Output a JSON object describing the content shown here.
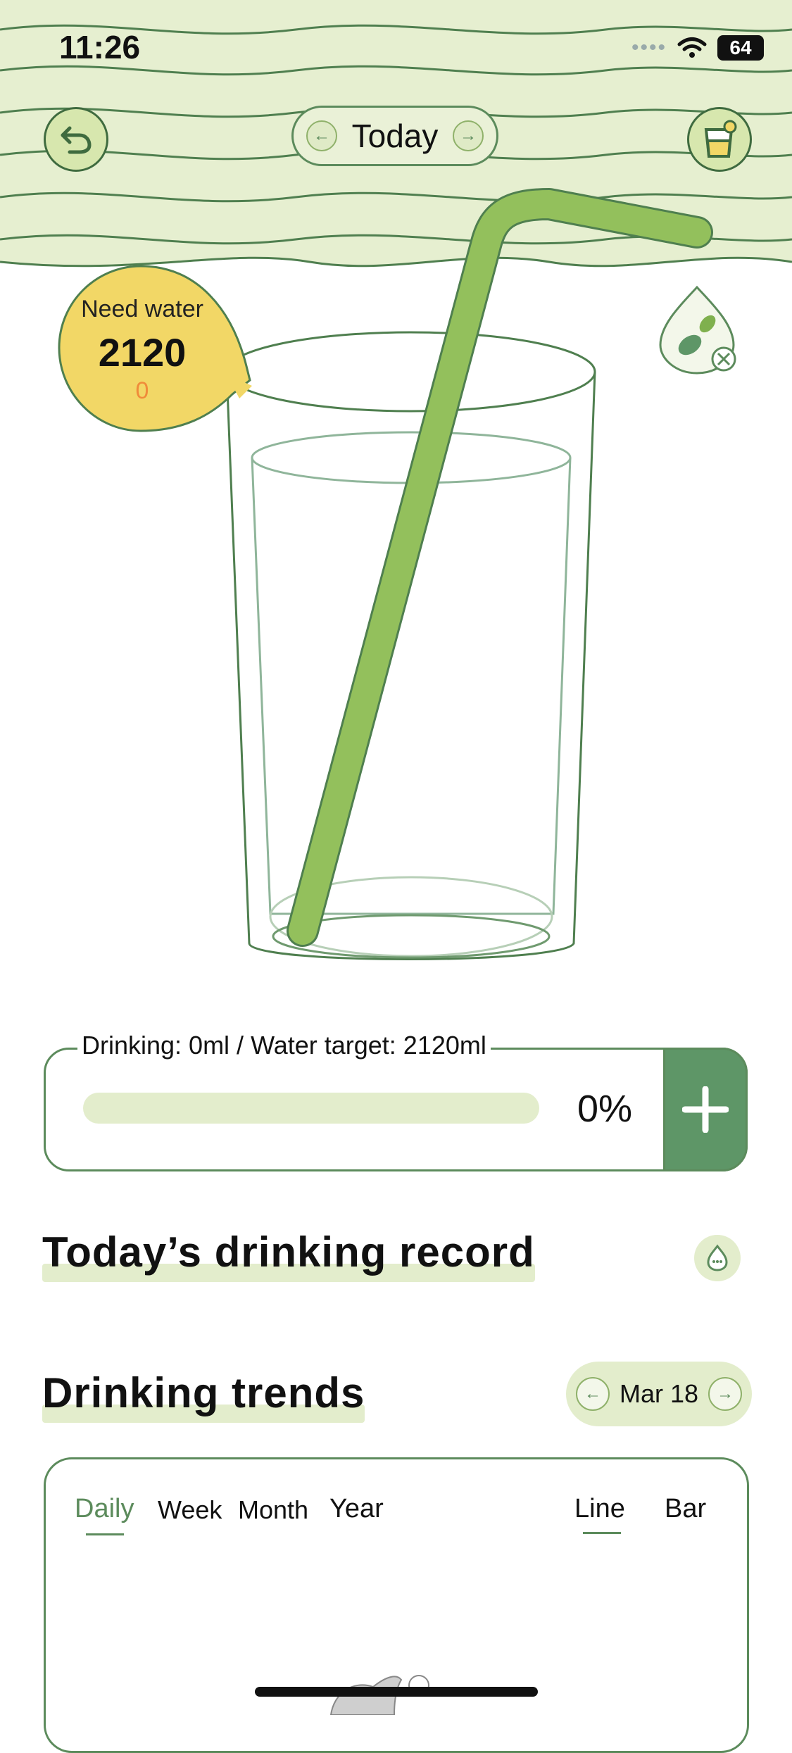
{
  "status_bar": {
    "time": "11:26",
    "battery": "64",
    "signal": "••••"
  },
  "header": {
    "date_label": "Today",
    "back_icon": "undo-icon",
    "cup_icon": "cup-icon"
  },
  "need_water": {
    "label": "Need water",
    "value": "2120",
    "sub_value": "0"
  },
  "progress": {
    "label": "Drinking: 0ml / Water target: 2120ml",
    "percent_text": "0%",
    "fraction": 0
  },
  "add_button": {
    "icon": "plus-icon"
  },
  "record": {
    "title": "Today’s drinking record",
    "icon": "water-drop-icon"
  },
  "trends": {
    "title": "Drinking trends",
    "date": "Mar 18",
    "tabs": [
      "Daily",
      "Week",
      "Month",
      "Year"
    ],
    "active_tab": "Daily",
    "chart_types": [
      "Line",
      "Bar"
    ],
    "active_chart_type": "Line"
  },
  "colors": {
    "accent": "#5c8b5c",
    "leaf_green": "#8fbf5c",
    "bubble_yellow": "#f2d766",
    "wave_bg": "#e6efd0"
  }
}
